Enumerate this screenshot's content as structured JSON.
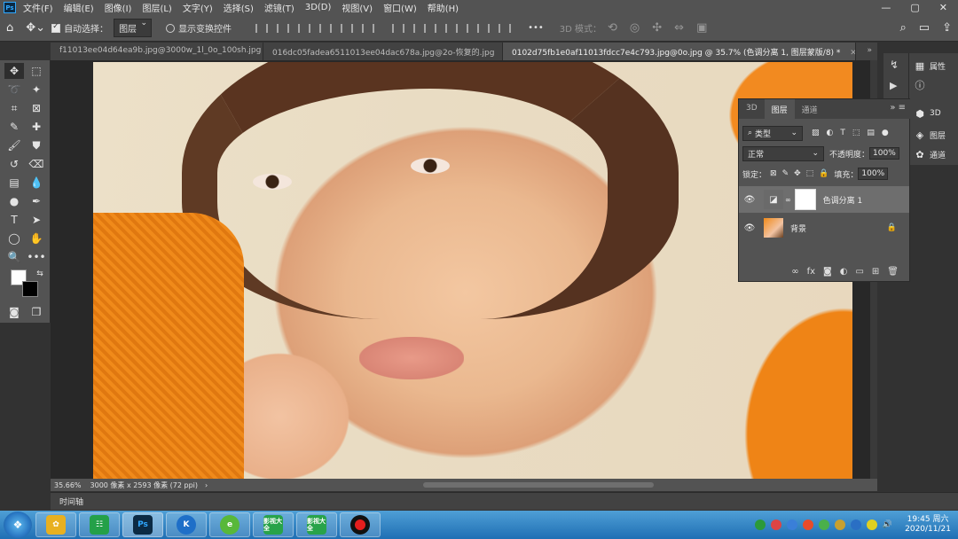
{
  "menubar": {
    "logo": "Ps",
    "items": [
      "文件(F)",
      "编辑(E)",
      "图像(I)",
      "图层(L)",
      "文字(Y)",
      "选择(S)",
      "滤镜(T)",
      "3D(D)",
      "视图(V)",
      "窗口(W)",
      "帮助(H)"
    ],
    "minimize": "—",
    "restore": "▢",
    "close": "✕"
  },
  "optionsbar": {
    "auto_select_label": "自动选择：",
    "auto_select_value": "图层",
    "show_transform_label": "显示变换控件",
    "more": "•••",
    "mode_label": "3D 模式："
  },
  "tabs": [
    {
      "label": "f11013ee04d64ea9b.jpg@3000w_1l_0o_100sh.jpg"
    },
    {
      "label": "016dc05fadea6511013ee04dac678a.jpg@2o-恢复的.jpg"
    },
    {
      "label": "0102d75fb1e0af11013fdcc7e4c793.jpg@0o.jpg @ 35.7% (色调分离 1, 图层蒙版/8) *"
    }
  ],
  "status": {
    "zoom": "35.66%",
    "doc_size": "3000 像素 x 2593 像素 (72 ppi)"
  },
  "timeline_label": "时间轴",
  "dock": {
    "properties_label": "属性",
    "label_3d": "3D",
    "layers_label": "图层",
    "channels_label": "通道"
  },
  "layers_panel": {
    "tabs": [
      "3D",
      "图层",
      "通道"
    ],
    "filter_kind": "类型",
    "blend_mode": "正常",
    "opacity_label": "不透明度：",
    "opacity_value": "100%",
    "lock_label": "锁定：",
    "fill_label": "填充：",
    "fill_value": "100%",
    "layers": [
      {
        "name": "色调分离 1",
        "selected": true
      },
      {
        "name": "背景",
        "selected": false
      }
    ],
    "footer_fx": "fx"
  },
  "taskbar": {
    "app_labels": [
      "Ps",
      "K",
      "影视大全",
      "影视大全"
    ],
    "time": "19:45 周六",
    "date": "2020/11/21"
  },
  "colors": {
    "accent": "#31a8ff",
    "fg": "#ffffff",
    "bg": "#000000"
  }
}
